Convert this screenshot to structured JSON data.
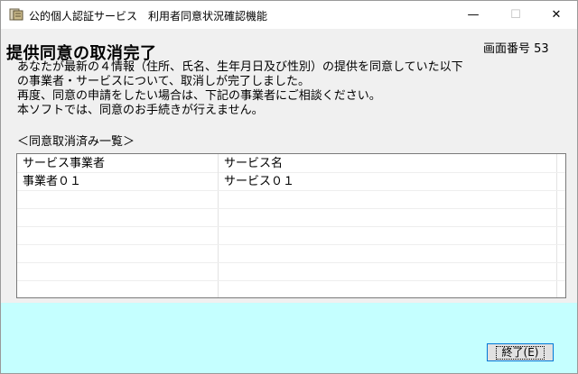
{
  "window": {
    "title": "公的個人認証サービス　利用者同意状況確認機能",
    "icon": "app-icon",
    "minimize_glyph": "—",
    "maximize_glyph": "☐",
    "close_glyph": "✕"
  },
  "header": {
    "title": "提供同意の取消完了",
    "screen_number": "画面番号 53"
  },
  "message": [
    "あなたが最新の４情報（住所、氏名、生年月日及び性別）の提供を同意していた以下",
    "の事業者・サービスについて、取消しが完了しました。",
    "再度、同意の申請をしたい場合は、下記の事業者にご相談ください。",
    "本ソフトでは、同意のお手続きが行えません。"
  ],
  "list": {
    "title": "＜同意取消済み一覧＞",
    "columns": [
      "サービス事業者",
      "サービス名"
    ],
    "rows": [
      [
        "事業者０１",
        "サービス０１"
      ]
    ]
  },
  "footer": {
    "end_button_label": "終了(E)",
    "panel_color": "#c5ffff"
  }
}
